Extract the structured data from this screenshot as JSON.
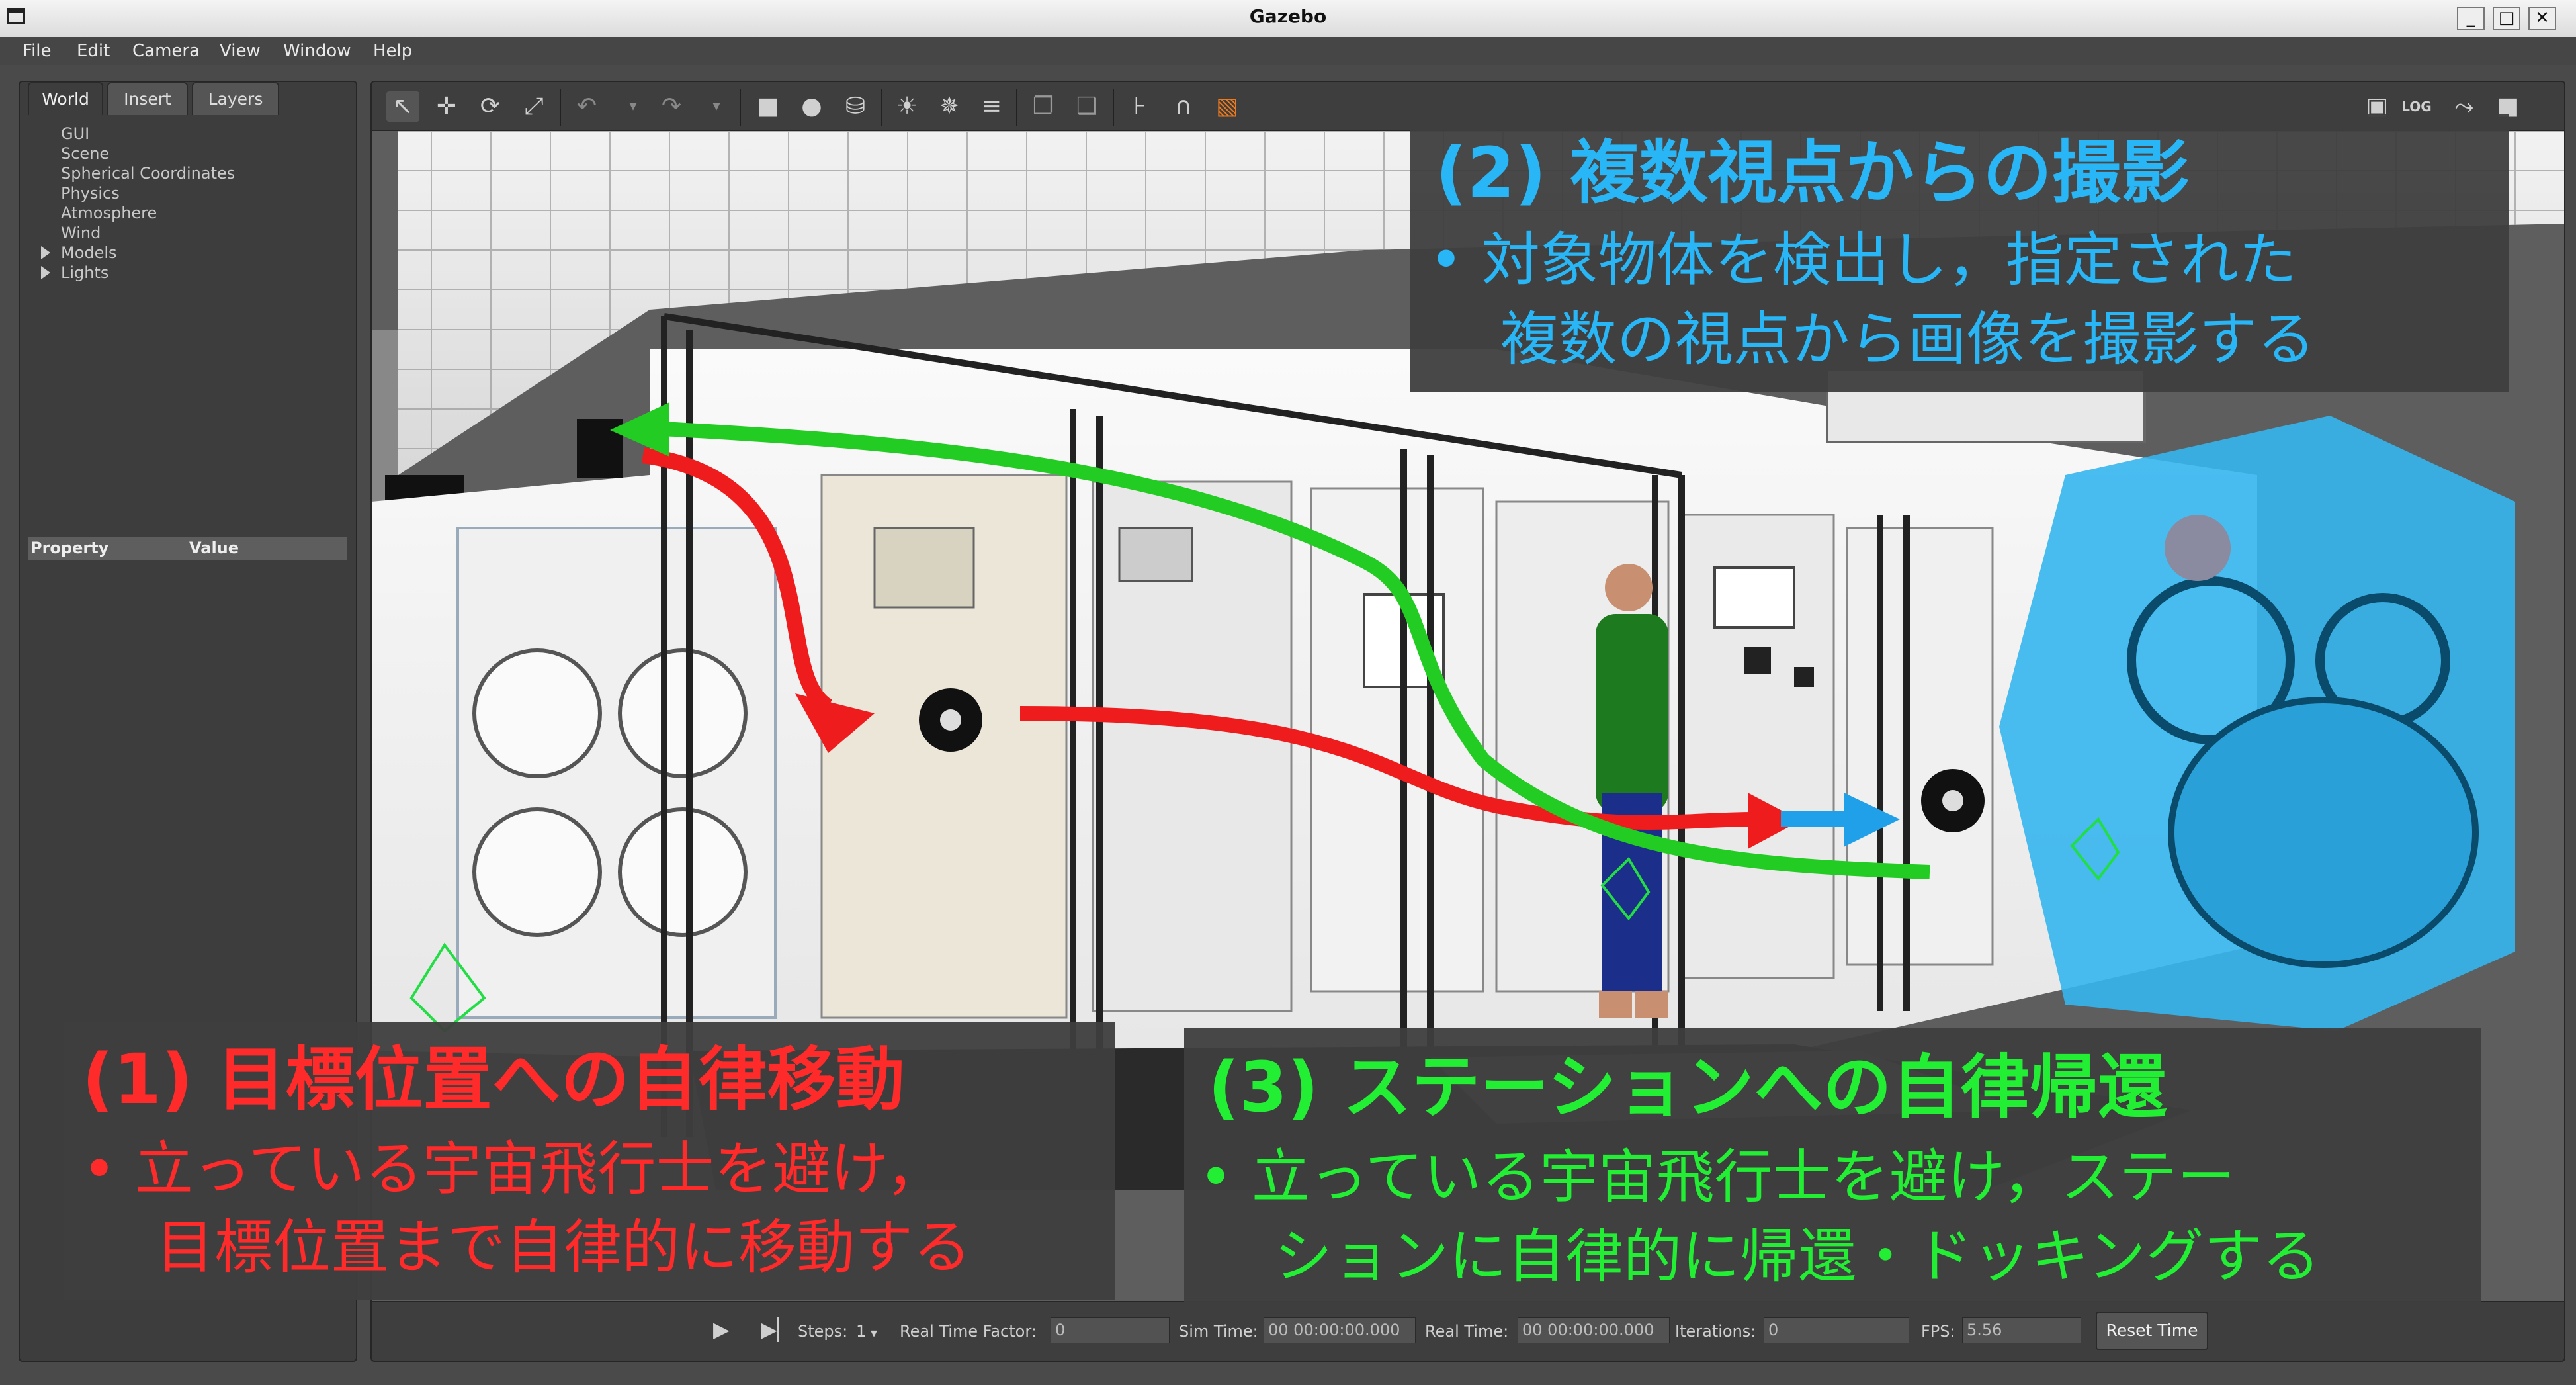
{
  "window": {
    "title": "Gazebo",
    "controls": [
      "_",
      "□",
      "✕"
    ]
  },
  "menubar": {
    "items": [
      "File",
      "Edit",
      "Camera",
      "View",
      "Window",
      "Help"
    ]
  },
  "left_panel": {
    "tabs": [
      "World",
      "Insert",
      "Layers"
    ],
    "active_tab": "World",
    "tree": [
      "GUI",
      "Scene",
      "Spherical Coordinates",
      "Physics",
      "Atmosphere",
      "Wind",
      "Models",
      "Lights"
    ],
    "expandable": [
      "Models",
      "Lights"
    ],
    "property_header": {
      "property": "Property",
      "value": "Value"
    }
  },
  "toolbar": {
    "left_tools": [
      "select-arrow-icon",
      "translate-icon",
      "rotate-icon",
      "scale-icon",
      "undo-icon",
      "redo-icon",
      "box-icon",
      "sphere-icon",
      "cylinder-icon",
      "point-light-icon",
      "spot-light-icon",
      "directional-light-icon",
      "copy-icon",
      "paste-icon",
      "align-icon",
      "snap-icon",
      "view-angle-icon"
    ],
    "right_tools": [
      "screenshot-icon",
      "log-icon",
      "plot-icon",
      "record-icon"
    ]
  },
  "overlays": {
    "task2": {
      "heading": "(2) 複数視点からの撮影",
      "line1": "•  対象物体を検出し，指定された",
      "line2": "複数の視点から画像を撮影する",
      "color": "#29b6f6"
    },
    "task1": {
      "heading": "(1) 目標位置への自律移動",
      "line1": "•  立っている宇宙飛行士を避け，",
      "line2": "目標位置まで自律的に移動する",
      "color": "#ff2a2a"
    },
    "task3": {
      "heading": "(3) ステーションへの自律帰還",
      "line1": "•  立っている宇宙飛行士を避け，ステー",
      "line2": "ションに自律的に帰還・ドッキングする",
      "color": "#22ee33"
    }
  },
  "bottom_bar": {
    "steps_label": "Steps:",
    "steps_value": "1",
    "rtf_label": "Real Time Factor:",
    "rtf_value": "0",
    "sim_time_label": "Sim Time:",
    "sim_time_value": "00 00:00:00.000",
    "real_time_label": "Real Time:",
    "real_time_value": "00 00:00:00.000",
    "iterations_label": "Iterations:",
    "iterations_value": "0",
    "fps_label": "FPS:",
    "fps_value": "5.56",
    "reset_label": "Reset Time"
  }
}
